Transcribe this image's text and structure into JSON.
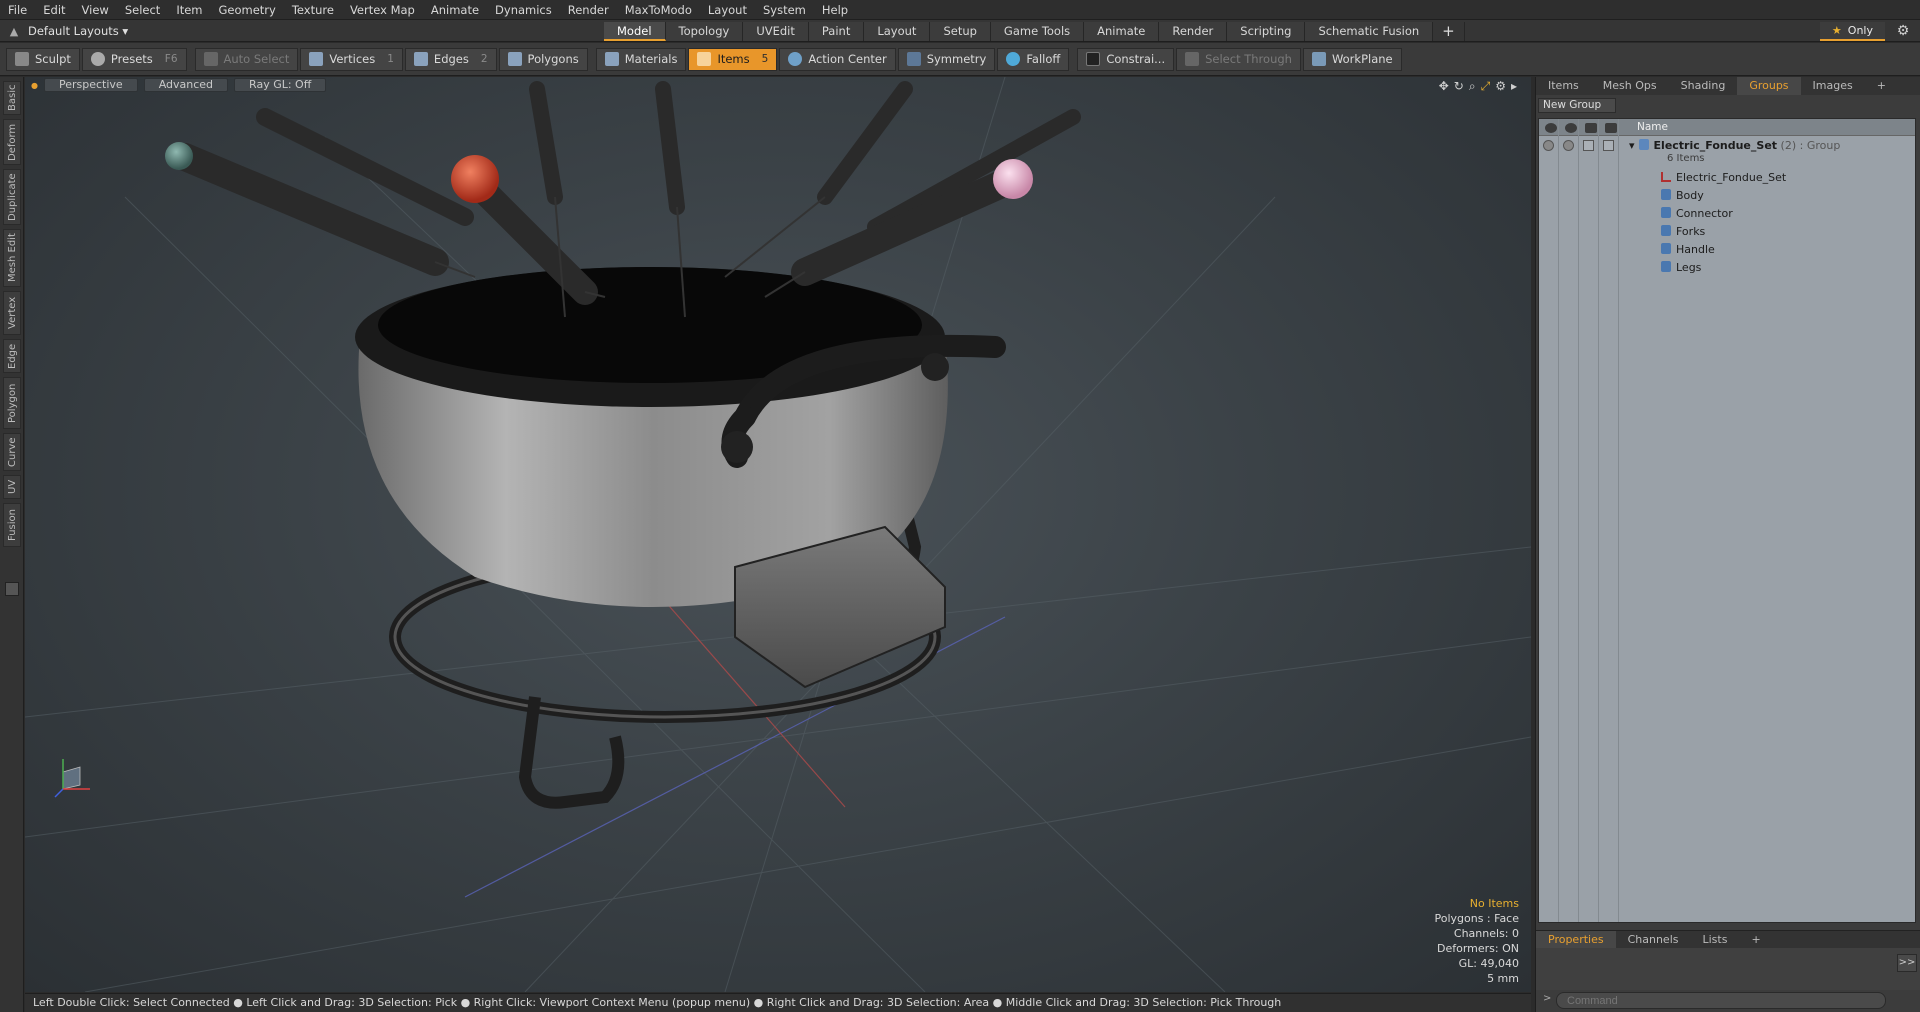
{
  "menu": [
    "File",
    "Edit",
    "View",
    "Select",
    "Item",
    "Geometry",
    "Texture",
    "Vertex Map",
    "Animate",
    "Dynamics",
    "Render",
    "MaxToModo",
    "Layout",
    "System",
    "Help"
  ],
  "layout_selector": "Default Layouts ▾",
  "tabs": [
    "Model",
    "Topology",
    "UVEdit",
    "Paint",
    "Layout",
    "Setup",
    "Game Tools",
    "Animate",
    "Render",
    "Scripting",
    "Schematic Fusion"
  ],
  "tab_plus": "+",
  "only_label": "Only",
  "toolbar": {
    "sculpt": "Sculpt",
    "presets": "Presets",
    "presets_key": "F6",
    "auto_select": "Auto Select",
    "vertices": "Vertices",
    "vertices_key": "1",
    "edges": "Edges",
    "edges_key": "2",
    "polygons": "Polygons",
    "materials": "Materials",
    "items": "Items",
    "items_key": "5",
    "action_center": "Action Center",
    "symmetry": "Symmetry",
    "falloff": "Falloff",
    "constrain": "Constrai...",
    "select_through": "Select Through",
    "workplane": "WorkPlane"
  },
  "left_tabs": [
    "Basic",
    "Deform",
    "Duplicate",
    "Mesh Edit",
    "Vertex",
    "Edge",
    "Polygon",
    "Curve",
    "UV",
    "Fusion"
  ],
  "viewport": {
    "perspective": "Perspective",
    "advanced": "Advanced",
    "raygl": "Ray GL: Off"
  },
  "hud": {
    "no_items": "No Items",
    "polygons": "Polygons : Face",
    "channels": "Channels: 0",
    "deformers": "Deformers: ON",
    "gl": "GL: 49,040",
    "unit": "5 mm"
  },
  "status": "Left Double Click: Select Connected ● Left Click and Drag: 3D Selection: Pick ● Right Click: Viewport Context Menu (popup menu) ● Right Click and Drag: 3D Selection: Area ● Middle Click and Drag: 3D Selection: Pick Through",
  "right_tabs": [
    "Items",
    "Mesh Ops",
    "Shading",
    "Groups",
    "Images"
  ],
  "right_tab_plus": "+",
  "new_group": "New Group",
  "tree": {
    "col_name": "Name",
    "group_name": "Electric_Fondue_Set",
    "group_suffix": "(2) : Group",
    "group_count": "6 Items",
    "items": [
      "Electric_Fondue_Set",
      "Body",
      "Connector",
      "Forks",
      "Handle",
      "Legs"
    ]
  },
  "bottom_tabs": [
    "Properties",
    "Channels",
    "Lists"
  ],
  "bottom_tab_plus": "+",
  "command_placeholder": "Command",
  "colors": {
    "accent": "#e8962a",
    "bg": "#3a3a3a"
  }
}
